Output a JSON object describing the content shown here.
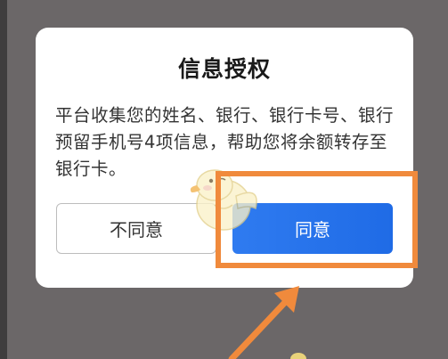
{
  "dialog": {
    "title": "信息授权",
    "body": "平台收集您的姓名、银行、银行卡号、银行预留手机号4项信息，帮助您将余额转存至银行卡。",
    "cancel_label": "不同意",
    "agree_label": "同意"
  },
  "colors": {
    "overlay": "#6b6768",
    "primary_button": "#2f7bf0",
    "annotation": "#f08a3c"
  },
  "annotations": {
    "highlight": "orange-rectangle",
    "pointer": "orange-arrow",
    "watermark": "duck-mascot"
  }
}
